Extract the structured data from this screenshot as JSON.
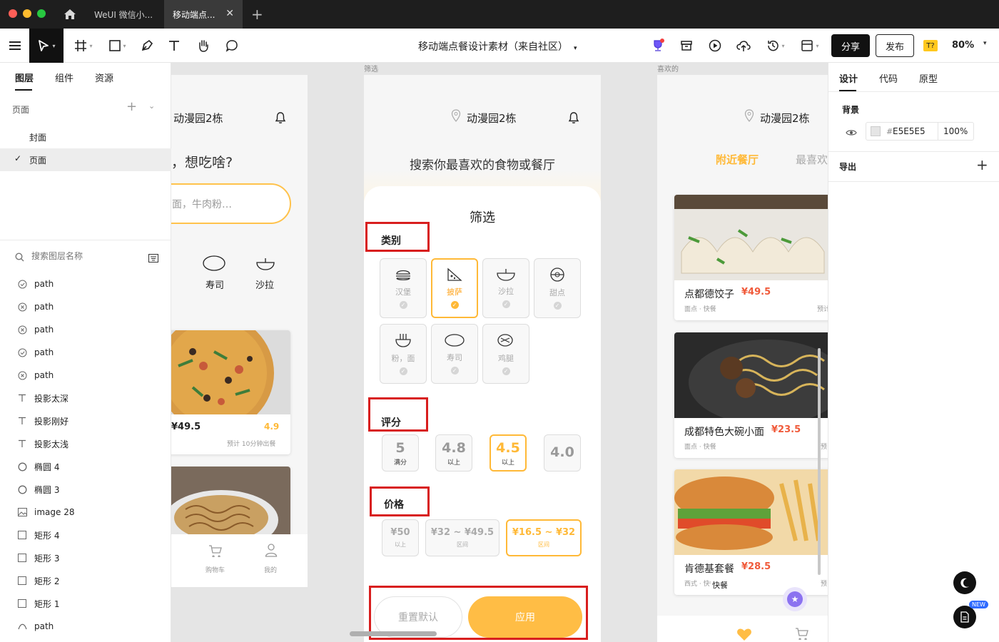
{
  "titlebar": {
    "tabs": [
      "WeUI 微信小...",
      "移动端点..."
    ]
  },
  "toolbar": {
    "doc_title": "移动端点餐设计素材（来自社区）",
    "share": "分享",
    "publish": "发布",
    "zoom": "80%",
    "badge": "T?"
  },
  "left_panel": {
    "tabs": [
      "图层",
      "组件",
      "资源"
    ],
    "pages_label": "页面",
    "pages": [
      "封面",
      "页面"
    ],
    "search_placeholder": "搜索图层名称",
    "layers": [
      {
        "icon": "check-circle-icon",
        "label": "path"
      },
      {
        "icon": "x-circle-icon",
        "label": "path"
      },
      {
        "icon": "x-circle-icon",
        "label": "path"
      },
      {
        "icon": "check-circle-icon",
        "label": "path"
      },
      {
        "icon": "x-circle-icon",
        "label": "path"
      },
      {
        "icon": "text-icon",
        "label": "投影太深"
      },
      {
        "icon": "text-icon",
        "label": "投影刚好"
      },
      {
        "icon": "text-icon",
        "label": "投影太浅"
      },
      {
        "icon": "ellipse-icon",
        "label": "椭圆 4"
      },
      {
        "icon": "ellipse-icon",
        "label": "椭圆 3"
      },
      {
        "icon": "image-icon",
        "label": "image 28"
      },
      {
        "icon": "rect-icon",
        "label": "矩形 4"
      },
      {
        "icon": "rect-icon",
        "label": "矩形 3"
      },
      {
        "icon": "rect-icon",
        "label": "矩形 2"
      },
      {
        "icon": "rect-icon",
        "label": "矩形 1"
      },
      {
        "icon": "path-icon",
        "label": "path"
      }
    ]
  },
  "frame1": {
    "location": "动漫园2栋",
    "prompt": "，想吃啥?",
    "search_hint": "面，牛肉粉…",
    "cats": [
      "寿司",
      "沙拉"
    ],
    "price": "¥49.5",
    "rating": "4.9",
    "eta": "预计 10分钟出餐",
    "nav": [
      "购物车",
      "我的"
    ]
  },
  "frame2": {
    "label": "筛选",
    "location": "动漫园2栋",
    "headline": "搜索你最喜欢的食物或餐厅",
    "sheet_title": "筛选",
    "category_title": "类别",
    "categories": [
      "汉堡",
      "披萨",
      "沙拉",
      "甜点",
      "粉，面",
      "寿司",
      "鸡腿"
    ],
    "rating_title": "评分",
    "ratings": [
      {
        "value": "5",
        "sub": "满分"
      },
      {
        "value": "4.8",
        "sub": "以上"
      },
      {
        "value": "4.5",
        "sub": "以上"
      },
      {
        "value": "4.0",
        "sub": ""
      }
    ],
    "price_title": "价格",
    "prices": [
      {
        "value": "¥50",
        "sub": "以上"
      },
      {
        "value": "¥32 ~ ¥49.5",
        "sub": "区间"
      },
      {
        "value": "¥16.5 ~ ¥32",
        "sub": "区间"
      }
    ],
    "reset": "重置默认",
    "apply": "应用"
  },
  "frame3": {
    "label": "喜欢的",
    "location": "动漫园2栋",
    "tab_active": "附近餐厅",
    "tab_other": "最喜欢",
    "cards": [
      {
        "name": "点都德饺子",
        "price": "¥49.5",
        "tags": "面点 · 快餐",
        "extra": "预计"
      },
      {
        "name": "成都特色大碗小面",
        "price": "¥23.5",
        "tags": "面点 · 快餐",
        "extra": "预"
      },
      {
        "name": "肯德基套餐",
        "price": "¥28.5",
        "tags": "西式 · 快餐",
        "extra": "预"
      }
    ],
    "overlay_text": "快餐"
  },
  "right_panel": {
    "tabs": [
      "设计",
      "代码",
      "原型"
    ],
    "background_label": "背景",
    "hash": "#",
    "color_hex": "E5E5E5",
    "opacity": "100%",
    "export_label": "导出",
    "new_badge": "NEW"
  },
  "colors": {
    "accent": "#FFB937",
    "price_red": "#F05A3A",
    "orange_text": "#FFA51F",
    "highlight_red": "#D81E1E"
  }
}
